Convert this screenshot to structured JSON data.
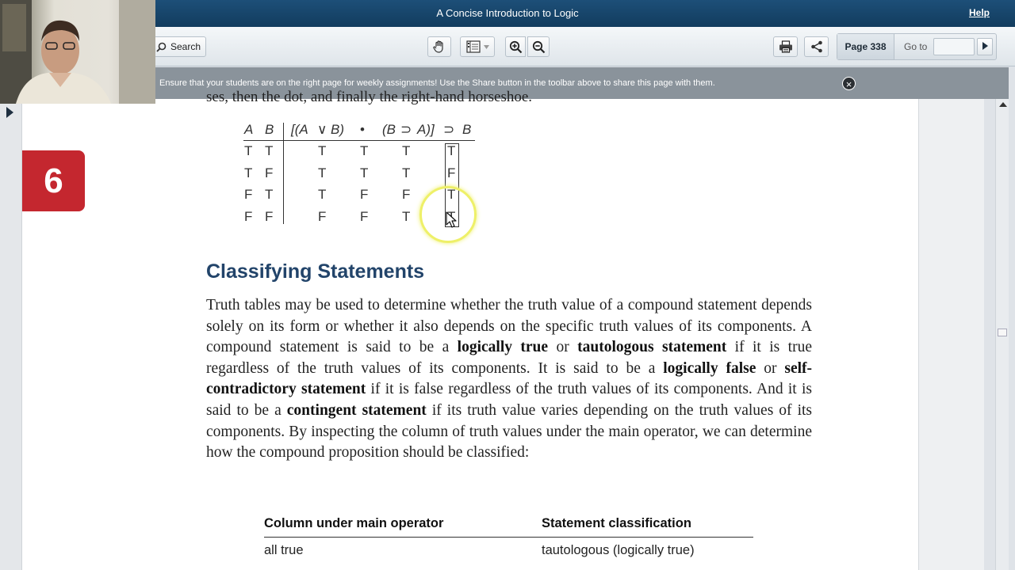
{
  "window": {
    "title": "A Concise Introduction to Logic",
    "help_label": "Help"
  },
  "toolbar": {
    "search_label": "Search",
    "page_label": "Page 338",
    "goto_label": "Go to",
    "goto_value": ""
  },
  "notice": {
    "message": "Ensure that your students are on the right page for weekly assignments! Use the Share button in the toolbar above to share this page with them.",
    "close_glyph": "×"
  },
  "chapter": {
    "number": "6"
  },
  "page": {
    "top_fragment": "ses, then the dot, and finally the right-hand horseshoe.",
    "truth_table": {
      "headers": [
        "A",
        "B",
        "[(A",
        "∨",
        "B)",
        "•",
        "(B",
        "⊃",
        "A)]",
        "⊃",
        "B"
      ],
      "rows": [
        [
          "T",
          "T",
          "T",
          "T",
          "T",
          "T"
        ],
        [
          "T",
          "F",
          "T",
          "T",
          "T",
          "F"
        ],
        [
          "F",
          "T",
          "T",
          "F",
          "F",
          "T"
        ],
        [
          "F",
          "F",
          "F",
          "F",
          "T",
          "T"
        ]
      ]
    },
    "heading": "Classifying Statements",
    "paragraph": [
      {
        "t": "Truth tables may be used to determine whether the truth value of a compound statement depends solely on its form or whether it also depends on the specific truth values of its components. A compound statement is said to be a ",
        "b": false
      },
      {
        "t": "logically true",
        "b": true
      },
      {
        "t": " or ",
        "b": false
      },
      {
        "t": "tautologous statement",
        "b": true
      },
      {
        "t": " if it is true regardless of the truth values of its components. It is said to be a ",
        "b": false
      },
      {
        "t": "logically false",
        "b": true
      },
      {
        "t": " or ",
        "b": false
      },
      {
        "t": "self-contradictory statement",
        "b": true
      },
      {
        "t": " if it is false regardless of the truth values of its components. And it is said to be a ",
        "b": false
      },
      {
        "t": "contingent statement",
        "b": true
      },
      {
        "t": " if its truth value varies depending on the truth values of its components. By inspecting the column of truth values under the main operator, we can determine how the compound proposition should be classified:",
        "b": false
      }
    ],
    "classification_table": {
      "col1_header": "Column under main operator",
      "col2_header": "Statement classification",
      "row1_col1": "all true",
      "row1_col2": "tautologous (logically true)"
    }
  },
  "colors": {
    "titlebar": "#1a4a70",
    "heading": "#22446a",
    "chapter_tab": "#c4272f",
    "notice_bg": "#8a939b",
    "cursor_highlight": "#eef068"
  }
}
